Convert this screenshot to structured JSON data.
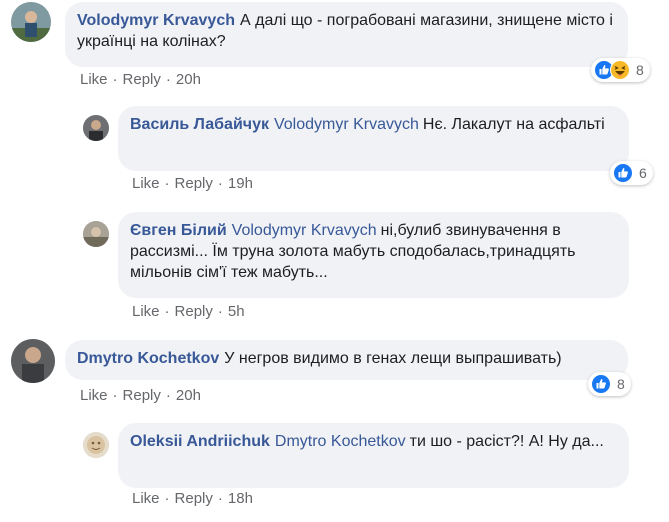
{
  "comments": [
    {
      "author": "Volodymyr Krvavych",
      "text": "А далі що - пограбовані магазини, знищене місто і українці на колінах?",
      "actions": {
        "like": "Like",
        "reply": "Reply",
        "time": "20h"
      },
      "reactions": {
        "icons": [
          "like-icon",
          "haha-icon"
        ],
        "count": "8"
      }
    },
    {
      "author": "Василь Лабайчук",
      "mention": "Volodymyr Krvavych",
      "text": "Нє. Лакалут на асфальті",
      "actions": {
        "like": "Like",
        "reply": "Reply",
        "time": "19h"
      },
      "reactions": {
        "icons": [
          "like-icon"
        ],
        "count": "6"
      }
    },
    {
      "author": "Євген Білий",
      "mention": "Volodymyr Krvavych",
      "text": "ні,булиб звинувачення в рассизмі... Їм труна золота мабуть сподобалась,тринадцять мільонів сім'ї теж мабуть...",
      "actions": {
        "like": "Like",
        "reply": "Reply",
        "time": "5h"
      }
    },
    {
      "author": "Dmytro Kochetkov",
      "text": "У негров видимо в генах лещи выпрашивать)",
      "actions": {
        "like": "Like",
        "reply": "Reply",
        "time": "20h"
      },
      "reactions": {
        "icons": [
          "like-icon"
        ],
        "count": "8"
      }
    },
    {
      "author": "Oleksii Andriichuk",
      "mention": "Dmytro Kochetkov",
      "text": "ти шо - расіст?! А! Ну да...",
      "actions": {
        "like": "Like",
        "reply": "Reply",
        "time": "18h"
      }
    }
  ],
  "colors": {
    "link": "#385898",
    "bubble": "#f0f2f5",
    "meta": "#65676b",
    "like_blue": "#1877f2",
    "haha_yellow": "#f7b928"
  }
}
